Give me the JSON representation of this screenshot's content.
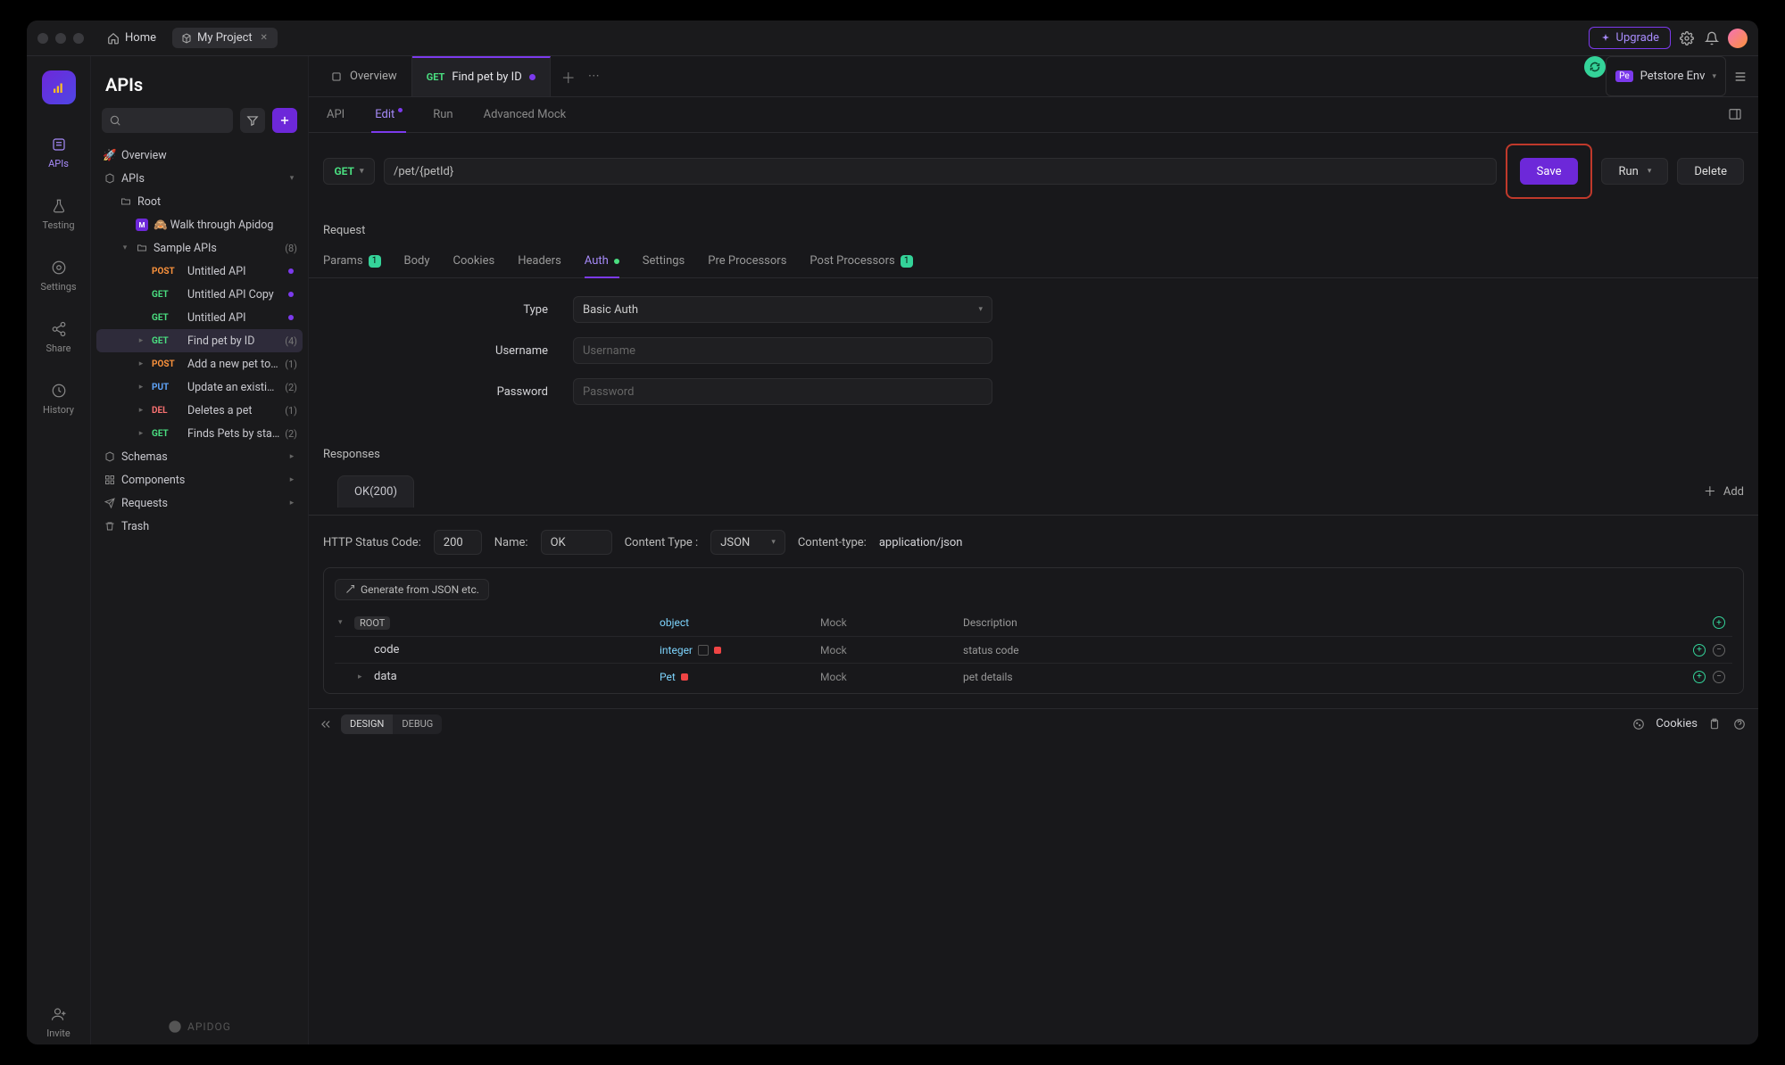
{
  "titlebar": {
    "home": "Home",
    "project": "My Project",
    "upgrade": "Upgrade"
  },
  "rail": {
    "items": [
      "APIs",
      "Testing",
      "Settings",
      "Share",
      "History"
    ],
    "invite": "Invite"
  },
  "sidebar": {
    "title": "APIs",
    "search_placeholder": "",
    "overview": "Overview",
    "apis_group": "APIs",
    "root": "Root",
    "walk": "🙈 Walk through Apidog",
    "sample": "Sample APIs",
    "sample_count": "(8)",
    "items": [
      {
        "method": "POST",
        "label": "Untitled API",
        "extra": "",
        "dot": true
      },
      {
        "method": "GET",
        "label": "Untitled API Copy",
        "extra": "",
        "dot": true
      },
      {
        "method": "GET",
        "label": "Untitled API",
        "extra": "",
        "dot": true
      },
      {
        "method": "GET",
        "label": "Find pet by ID",
        "extra": "(4)",
        "selected": true,
        "chev": true
      },
      {
        "method": "POST",
        "label": "Add a new pet to th…",
        "extra": "(1)",
        "chev": true
      },
      {
        "method": "PUT",
        "label": "Update an existing p…",
        "extra": "(2)",
        "chev": true
      },
      {
        "method": "DEL",
        "label": "Deletes a pet",
        "extra": "(1)",
        "chev": true
      },
      {
        "method": "GET",
        "label": "Finds Pets by status",
        "extra": "(2)",
        "chev": true
      }
    ],
    "schemas": "Schemas",
    "components": "Components",
    "requests": "Requests",
    "trash": "Trash",
    "brand": "APIDOG"
  },
  "maintabs": {
    "overview": "Overview",
    "current_method": "GET",
    "current_title": "Find pet by ID"
  },
  "env": {
    "badge": "Pe",
    "name": "Petstore Env"
  },
  "subtabs": {
    "api": "API",
    "edit": "Edit",
    "run": "Run",
    "mock": "Advanced Mock"
  },
  "methodrow": {
    "method": "GET",
    "url": "/pet/{petId}",
    "save": "Save",
    "run": "Run",
    "delete": "Delete"
  },
  "request": {
    "label": "Request",
    "tabs": {
      "params": "Params",
      "params_count": "1",
      "body": "Body",
      "cookies": "Cookies",
      "headers": "Headers",
      "auth": "Auth",
      "settings": "Settings",
      "pre": "Pre Processors",
      "post": "Post Processors",
      "post_count": "1"
    },
    "auth": {
      "type_label": "Type",
      "type_value": "Basic Auth",
      "username_label": "Username",
      "username_placeholder": "Username",
      "password_label": "Password",
      "password_placeholder": "Password"
    }
  },
  "responses": {
    "label": "Responses",
    "tab": "OK(200)",
    "add": "Add",
    "status_label": "HTTP Status Code:",
    "status_value": "200",
    "name_label": "Name:",
    "name_value": "OK",
    "ctype_label": "Content Type :",
    "ctype_value": "JSON",
    "ctypehdr_label": "Content-type:",
    "ctypehdr_value": "application/json",
    "generate": "Generate from JSON etc.",
    "cols": {
      "mock": "Mock",
      "desc": "Description"
    },
    "rows": [
      {
        "name": "ROOT",
        "type": "object",
        "required": false,
        "mock": "Mock",
        "desc": "Description",
        "header": true,
        "expander": "▾",
        "indent": 0
      },
      {
        "name": "code",
        "type": "integer",
        "required": true,
        "mock": "Mock",
        "desc": "status code",
        "ref": true,
        "indent": 1
      },
      {
        "name": "data",
        "type": "Pet",
        "required": true,
        "mock": "Mock",
        "desc": "pet details",
        "expander": "▸",
        "indent": 1
      }
    ]
  },
  "bottombar": {
    "design": "DESIGN",
    "debug": "DEBUG",
    "cookies": "Cookies"
  }
}
